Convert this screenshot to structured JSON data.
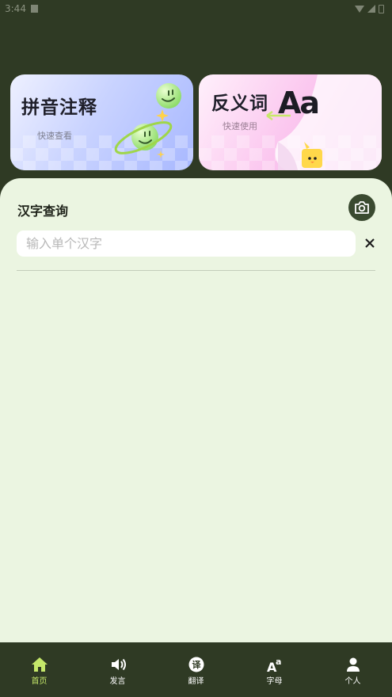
{
  "status_bar": {
    "time": "3:44"
  },
  "cards": [
    {
      "title": "拼音注释",
      "subtitle": "快速查看"
    },
    {
      "title": "反义词",
      "subtitle": "快速使用",
      "art_text": "Aa"
    }
  ],
  "lookup": {
    "title": "汉字查询",
    "input_value": "",
    "input_placeholder": "输入单个汉字"
  },
  "nav": {
    "items": [
      {
        "label": "首页",
        "icon": "home-icon",
        "active": true
      },
      {
        "label": "发言",
        "icon": "speaker-icon",
        "active": false
      },
      {
        "label": "翻译",
        "icon": "translate-icon",
        "active": false
      },
      {
        "label": "字母",
        "icon": "letters-icon",
        "active": false
      },
      {
        "label": "个人",
        "icon": "person-icon",
        "active": false
      }
    ],
    "active_color": "#c5e86a"
  }
}
